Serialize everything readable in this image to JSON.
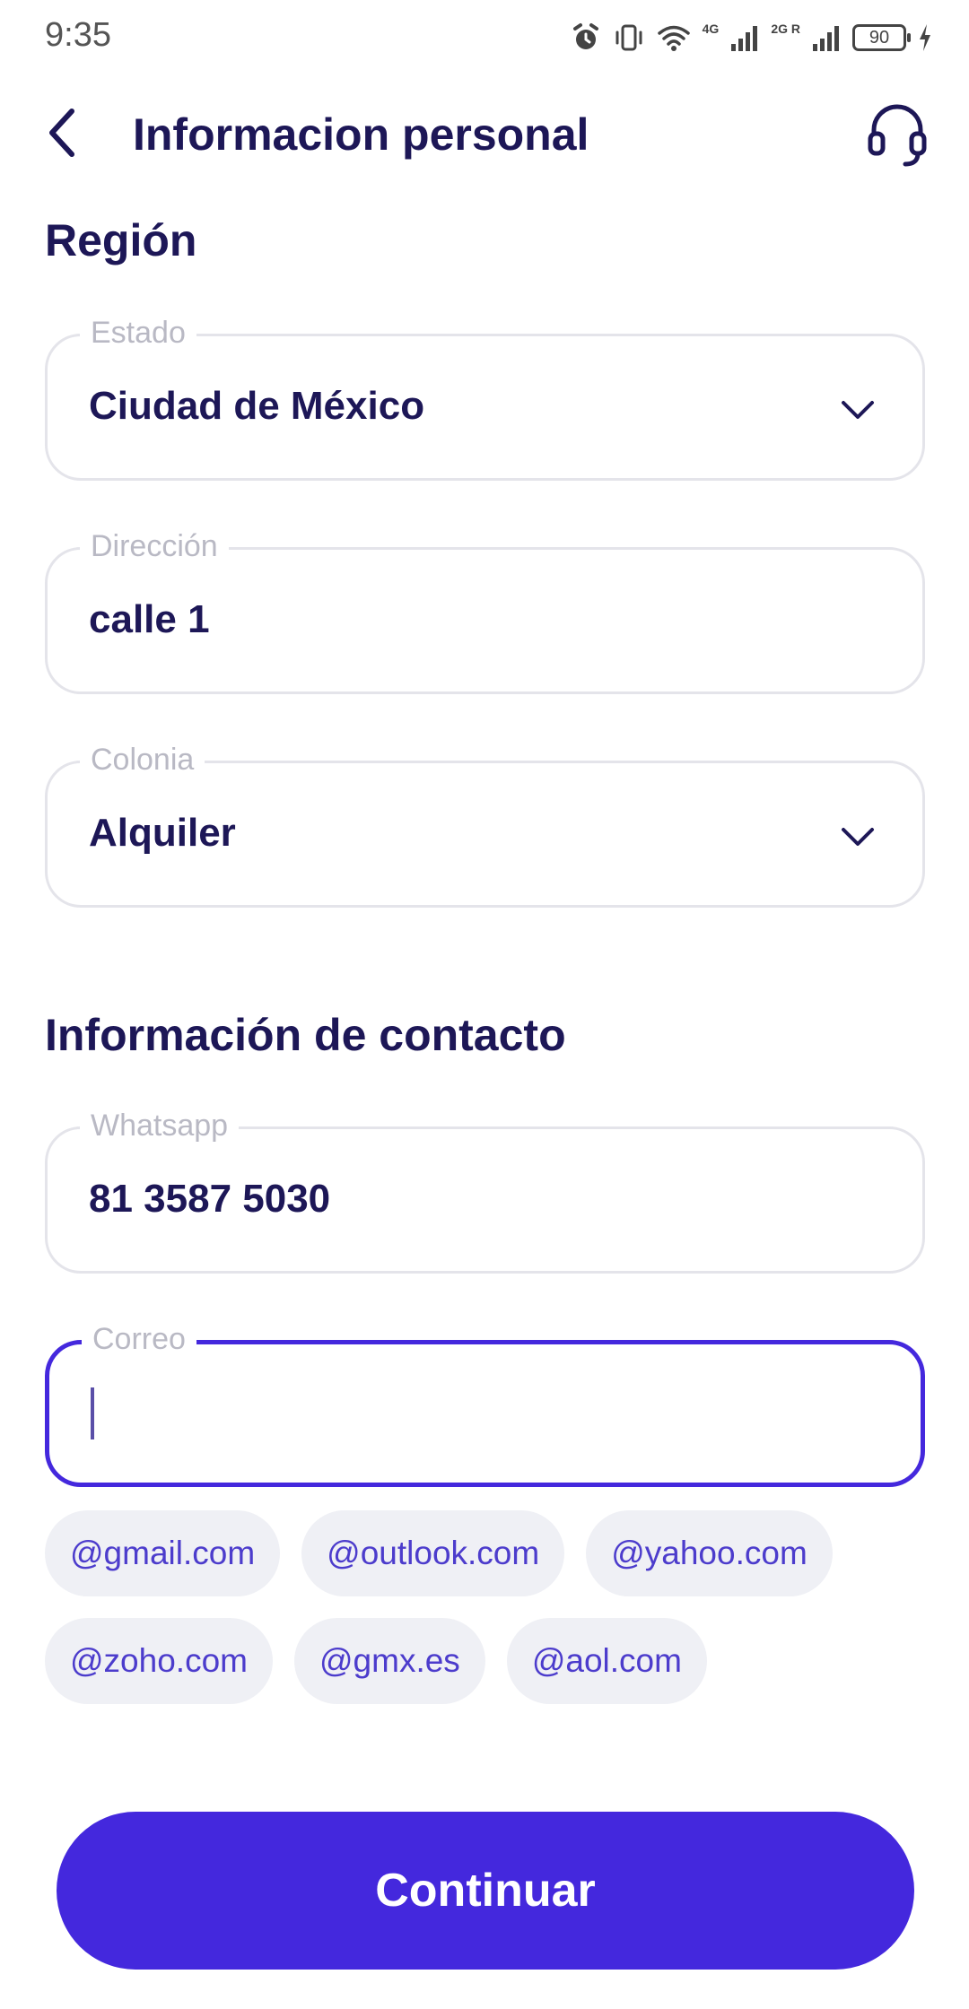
{
  "status_bar": {
    "time": "9:35",
    "network_4g": "4G",
    "network_2g": "2G R",
    "battery": "90"
  },
  "header": {
    "title": "Informacion personal",
    "back_icon": "chevron-left-icon",
    "support_icon": "headset-icon"
  },
  "region": {
    "title": "Región",
    "estado": {
      "label": "Estado",
      "value": "Ciudad de México"
    },
    "direccion": {
      "label": "Dirección",
      "value": "calle 1"
    },
    "colonia": {
      "label": "Colonia",
      "value": "Alquiler"
    }
  },
  "contact": {
    "title": "Información de contacto",
    "whatsapp": {
      "label": "Whatsapp",
      "value": "81 3587 5030"
    },
    "correo": {
      "label": "Correo",
      "value": ""
    },
    "domains": [
      "@gmail.com",
      "@outlook.com",
      "@yahoo.com",
      "@zoho.com",
      "@gmx.es",
      "@aol.com"
    ]
  },
  "continue_label": "Continuar",
  "colors": {
    "primary": "#4428dd",
    "text": "#1d1757",
    "chip_bg": "#eff0f5",
    "chip_text": "#4c3ccc",
    "field_border": "#e4e4ea",
    "label": "#b9b9c4"
  }
}
